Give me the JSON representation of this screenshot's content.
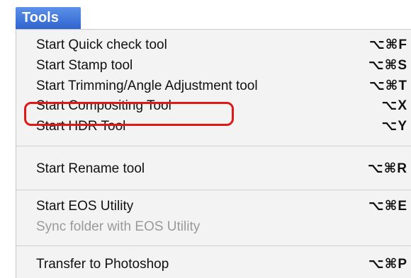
{
  "menu": {
    "title": "Tools",
    "items": [
      {
        "label": "Start Quick check tool",
        "shortcut": "⌥⌘F",
        "enabled": true
      },
      {
        "label": "Start Stamp tool",
        "shortcut": "⌥⌘S",
        "enabled": true
      },
      {
        "label": "Start Trimming/Angle Adjustment tool",
        "shortcut": "⌥⌘T",
        "enabled": true
      },
      {
        "label": "Start Compositing Tool",
        "shortcut": "⌥X",
        "enabled": true,
        "highlighted": true
      },
      {
        "label": "Start HDR Tool",
        "shortcut": "⌥Y",
        "enabled": true
      },
      {
        "label": "Start Rename tool",
        "shortcut": "⌥⌘R",
        "enabled": true
      },
      {
        "label": "Start EOS Utility",
        "shortcut": "⌥⌘E",
        "enabled": true
      },
      {
        "label": "Sync folder with EOS Utility",
        "shortcut": "",
        "enabled": false
      },
      {
        "label": "Transfer to Photoshop",
        "shortcut": "⌥⌘P",
        "enabled": true
      }
    ]
  },
  "colors": {
    "menu_title_bg": "#3a72d9",
    "menu_bg": "#f3f3f3",
    "highlight_ring": "#e01818",
    "disabled_text": "#9a9a9a"
  }
}
